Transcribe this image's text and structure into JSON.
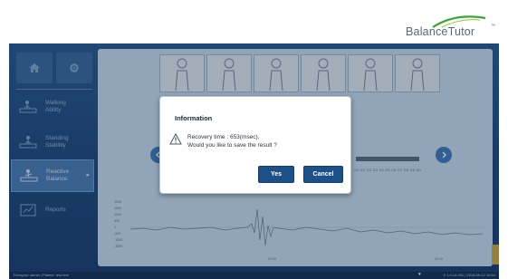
{
  "brand": {
    "name": "BalanceTutor",
    "trademark": "™",
    "accent_color": "#3fa33a"
  },
  "sidebar": {
    "top_buttons": [
      {
        "icon": "home-icon"
      },
      {
        "icon": "gear-icon"
      }
    ],
    "items": [
      {
        "label": "Walking\nAbility",
        "icon": "walking-ability-icon",
        "active": false
      },
      {
        "label": "Standing\nStability",
        "icon": "standing-stability-icon",
        "active": false
      },
      {
        "label": "Reactive\nBalance",
        "icon": "reactive-balance-icon",
        "active": true
      },
      {
        "label": "Reports",
        "icon": "reports-icon",
        "active": false
      }
    ]
  },
  "main": {
    "figure_count": 6,
    "scale_numbers": "20 21 22 23 24 25 26 27 28 29 30",
    "graph": {
      "y_ticks": [
        "2000",
        "1500",
        "1000",
        "500",
        "0",
        "-500",
        "-1000",
        "-1500"
      ],
      "x_ticks": [
        "00:05",
        "00:10"
      ]
    }
  },
  "footer": {
    "left": "Therapist: admin  |  Patient: test test",
    "right": "V 1.0.14.001  |  2018-09-12 16:54"
  },
  "dialog": {
    "title": "Information",
    "line1": "Recovery time : 653(msec).",
    "line2": "Would you like to save the result ?",
    "yes_label": "Yes",
    "cancel_label": "Cancel",
    "icon": "warning-icon"
  },
  "colors": {
    "app_bg": "#2a5b91",
    "panel_bg": "#c6dcef",
    "button_bg": "#1e4f86",
    "active_nav": "#4a7fb8"
  }
}
